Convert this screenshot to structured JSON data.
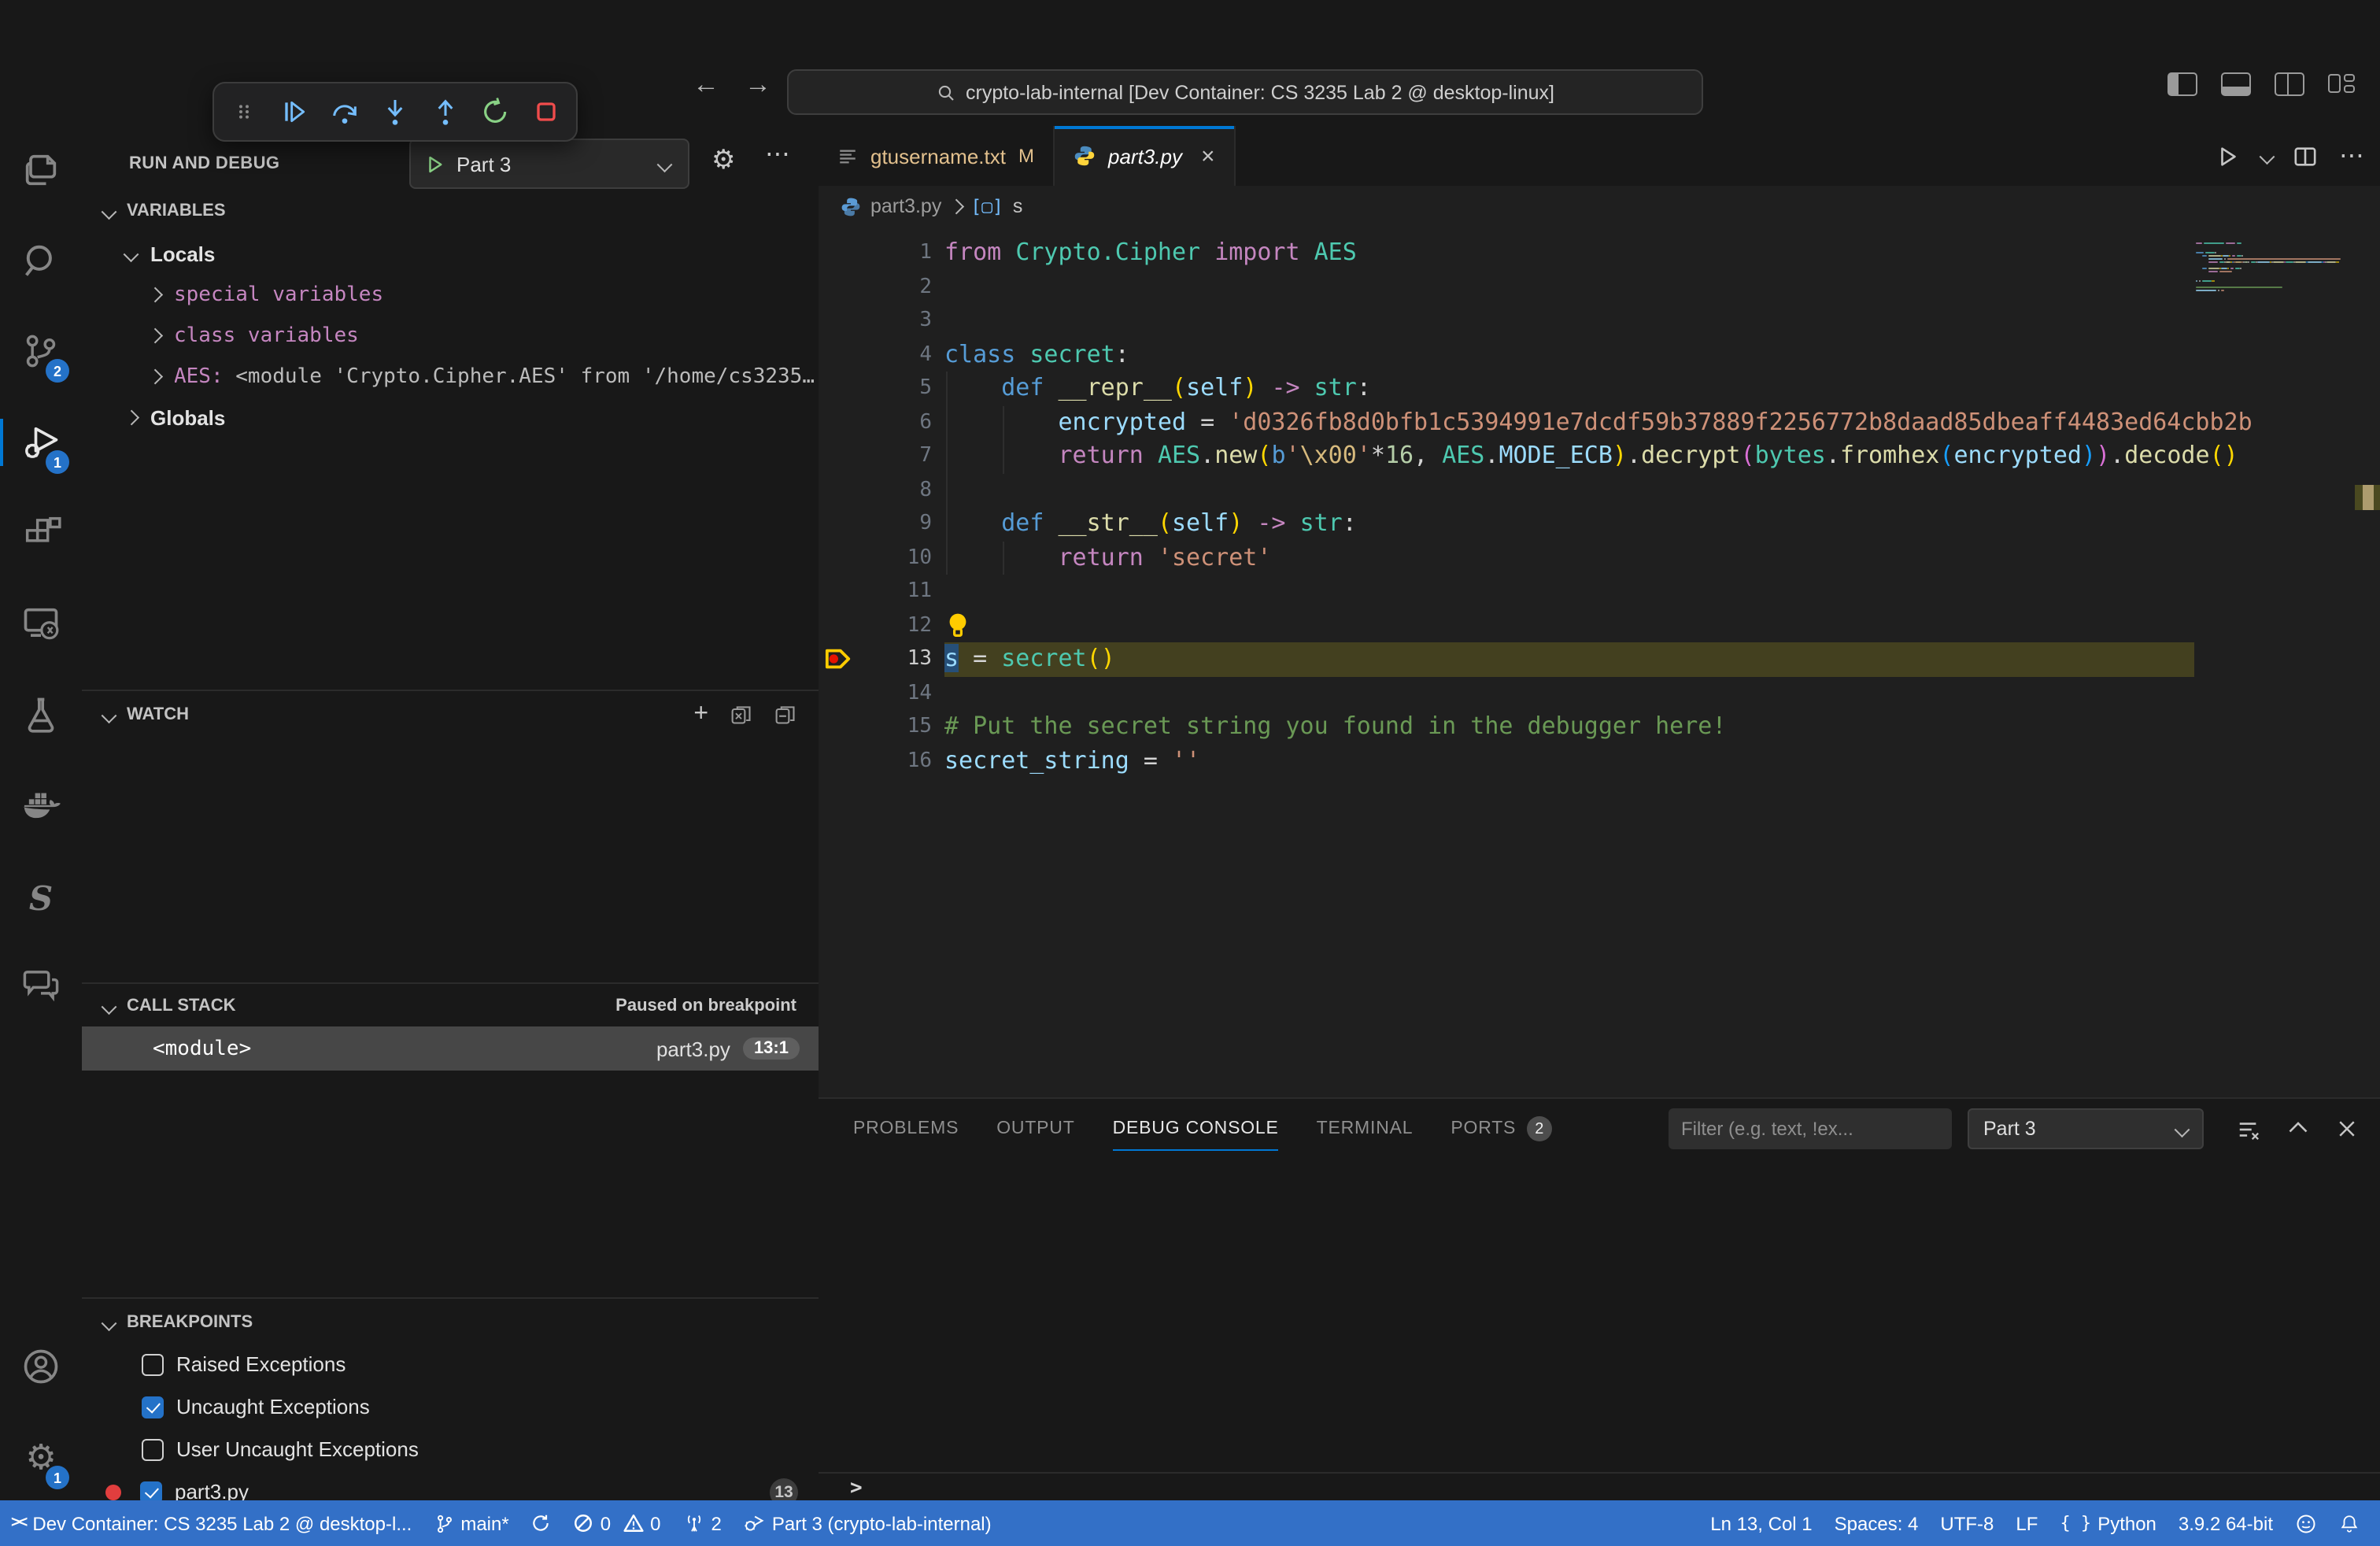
{
  "window": {
    "search_title": "crypto-lab-internal [Dev Container: CS 3235 Lab 2 @ desktop-linux]"
  },
  "debug_toolbar": {
    "buttons": [
      "gripper",
      "continue",
      "step-over",
      "step-into",
      "step-out",
      "restart",
      "stop"
    ]
  },
  "activity_bar": {
    "items": [
      {
        "name": "explorer"
      },
      {
        "name": "search"
      },
      {
        "name": "source-control",
        "badge": "2"
      },
      {
        "name": "run-and-debug",
        "badge": "1",
        "active": true
      },
      {
        "name": "extensions"
      },
      {
        "name": "remote-explorer"
      },
      {
        "name": "testing"
      },
      {
        "name": "docker"
      },
      {
        "name": "s-extension"
      },
      {
        "name": "comments"
      }
    ],
    "bottom_items": [
      {
        "name": "accounts"
      },
      {
        "name": "settings",
        "badge": "1"
      }
    ]
  },
  "sidebar": {
    "title": "RUN AND DEBUG",
    "config_dropdown": {
      "label": "Part 3"
    },
    "variables": {
      "header": "VARIABLES",
      "rows": [
        {
          "label": "Locals",
          "indent": 1,
          "expanded": true,
          "color": "#e3e3e3",
          "bold": true
        },
        {
          "label": "special variables",
          "indent": 2,
          "expanded": false,
          "color": "#c586c0"
        },
        {
          "label": "class variables",
          "indent": 2,
          "expanded": false,
          "color": "#c586c0"
        },
        {
          "label": "AES: ",
          "value": "<module 'Crypto.Cipher.AES' from '/home/cs3235…",
          "indent": 2,
          "expanded": false,
          "color": "#c586c0"
        },
        {
          "label": "Globals",
          "indent": 1,
          "expanded": false,
          "color": "#e3e3e3",
          "bold": true
        }
      ]
    },
    "watch": {
      "header": "WATCH",
      "actions": [
        "add-expression",
        "remove-all-expressions",
        "collapse-all"
      ]
    },
    "call_stack": {
      "header": "CALL STACK",
      "status": "Paused on breakpoint",
      "frames": [
        {
          "name": "<module>",
          "file": "part3.py",
          "position": "13:1"
        }
      ]
    },
    "breakpoints": {
      "header": "BREAKPOINTS",
      "items": [
        {
          "label": "Raised Exceptions",
          "checked": false
        },
        {
          "label": "Uncaught Exceptions",
          "checked": true
        },
        {
          "label": "User Uncaught Exceptions",
          "checked": false
        },
        {
          "label": "part3.py",
          "checked": true,
          "dot": true,
          "badge": "13"
        }
      ]
    }
  },
  "editor": {
    "tabs": [
      {
        "label": "gtusername.txt",
        "icon": "text-file",
        "modified_badge": "M",
        "active": false
      },
      {
        "label": "part3.py",
        "icon": "python",
        "active": true,
        "italic": true,
        "close": "×"
      }
    ],
    "breadcrumb": {
      "file": "part3.py",
      "symbol": "s"
    },
    "code": {
      "current_line": 13,
      "breakpoint_line": 13,
      "lightbulb_line": 12,
      "token_colors": {
        "kb": "#569CD6",
        "kp": "#C586C0",
        "ty": "#4EC9B0",
        "fn": "#DCDCAA",
        "va": "#9CDCFE",
        "st": "#CE9178",
        "es": "#D7BA7D",
        "nu": "#B5CEA8",
        "co": "#6A9955",
        "pl": "#D4D4D4",
        "p1": "#FFD700",
        "p2": "#DA70D6",
        "p3": "#179FFF"
      },
      "lines": [
        [
          [
            "from",
            "kp"
          ],
          [
            " ",
            "pl"
          ],
          [
            "Crypto.Cipher",
            "ty"
          ],
          [
            " ",
            "pl"
          ],
          [
            "import",
            "kp"
          ],
          [
            " ",
            "pl"
          ],
          [
            "AES",
            "ty"
          ]
        ],
        [],
        [],
        [
          [
            "class",
            "kb"
          ],
          [
            " ",
            "pl"
          ],
          [
            "secret",
            "ty"
          ],
          [
            ":",
            "pl"
          ]
        ],
        [
          [
            "    ",
            "pl"
          ],
          [
            "def",
            "kb"
          ],
          [
            " ",
            "pl"
          ],
          [
            "__repr__",
            "fn"
          ],
          [
            "(",
            "p1"
          ],
          [
            "self",
            "va"
          ],
          [
            ")",
            "p1"
          ],
          [
            " ",
            "pl"
          ],
          [
            "->",
            "kp"
          ],
          [
            " ",
            "pl"
          ],
          [
            "str",
            "ty"
          ],
          [
            ":",
            "pl"
          ]
        ],
        [
          [
            "        ",
            "pl"
          ],
          [
            "encrypted",
            "va"
          ],
          [
            " ",
            "pl"
          ],
          [
            "=",
            "pl"
          ],
          [
            " ",
            "pl"
          ],
          [
            "'d0326fb8d0bfb1c5394991e7dcdf59b37889f2256772b8daad85dbeaff4483ed64cbb2b",
            "st"
          ]
        ],
        [
          [
            "        ",
            "pl"
          ],
          [
            "return",
            "kp"
          ],
          [
            " ",
            "pl"
          ],
          [
            "AES",
            "ty"
          ],
          [
            ".",
            "pl"
          ],
          [
            "new",
            "fn"
          ],
          [
            "(",
            "p1"
          ],
          [
            "b",
            "kb"
          ],
          [
            "'",
            "st"
          ],
          [
            "\\x00",
            "es"
          ],
          [
            "'",
            "st"
          ],
          [
            "*",
            "pl"
          ],
          [
            "16",
            "nu"
          ],
          [
            ",",
            "pl"
          ],
          [
            " ",
            "pl"
          ],
          [
            "AES",
            "ty"
          ],
          [
            ".",
            "pl"
          ],
          [
            "MODE_ECB",
            "va"
          ],
          [
            ")",
            "p1"
          ],
          [
            ".",
            "pl"
          ],
          [
            "decrypt",
            "fn"
          ],
          [
            "(",
            "p2"
          ],
          [
            "bytes",
            "ty"
          ],
          [
            ".",
            "pl"
          ],
          [
            "fromhex",
            "fn"
          ],
          [
            "(",
            "p3"
          ],
          [
            "encrypted",
            "va"
          ],
          [
            ")",
            "p3"
          ],
          [
            ")",
            "p2"
          ],
          [
            ".",
            "pl"
          ],
          [
            "decode",
            "fn"
          ],
          [
            "(",
            "p1"
          ],
          [
            ")",
            "p1"
          ]
        ],
        [],
        [
          [
            "    ",
            "pl"
          ],
          [
            "def",
            "kb"
          ],
          [
            " ",
            "pl"
          ],
          [
            "__str__",
            "fn"
          ],
          [
            "(",
            "p1"
          ],
          [
            "self",
            "va"
          ],
          [
            ")",
            "p1"
          ],
          [
            " ",
            "pl"
          ],
          [
            "->",
            "kp"
          ],
          [
            " ",
            "pl"
          ],
          [
            "str",
            "ty"
          ],
          [
            ":",
            "pl"
          ]
        ],
        [
          [
            "        ",
            "pl"
          ],
          [
            "return",
            "kp"
          ],
          [
            " ",
            "pl"
          ],
          [
            "'secret'",
            "st"
          ]
        ],
        [],
        [],
        [
          [
            "s",
            "va",
            "sel"
          ],
          [
            " ",
            "pl"
          ],
          [
            "=",
            "pl"
          ],
          [
            " ",
            "pl"
          ],
          [
            "secret",
            "ty"
          ],
          [
            "(",
            "p1"
          ],
          [
            ")",
            "p1"
          ]
        ],
        [],
        [
          [
            "# Put the secret string you found in the debugger here!",
            "co"
          ]
        ],
        [
          [
            "secret_string",
            "va"
          ],
          [
            " ",
            "pl"
          ],
          [
            "=",
            "pl"
          ],
          [
            " ",
            "pl"
          ],
          [
            "''",
            "st"
          ]
        ]
      ]
    }
  },
  "panel": {
    "tabs": [
      {
        "label": "PROBLEMS"
      },
      {
        "label": "OUTPUT"
      },
      {
        "label": "DEBUG CONSOLE",
        "active": true
      },
      {
        "label": "TERMINAL"
      },
      {
        "label": "PORTS",
        "badge": "2"
      }
    ],
    "filter_placeholder": "Filter (e.g. text, !ex...",
    "dropdown": {
      "label": "Part 3"
    }
  },
  "status_bar": {
    "left": [
      {
        "icon": "remote-icon",
        "text": "Dev Container: CS 3235 Lab 2 @ desktop-l..."
      },
      {
        "icon": "branch-icon",
        "text": "main*"
      },
      {
        "icon": "sync-icon",
        "text": ""
      },
      {
        "icon": "errors-warnings-icon",
        "text": "0|0"
      },
      {
        "icon": "radio-tower-icon",
        "text": "2"
      },
      {
        "icon": "debug-icon",
        "text": "Part 3 (crypto-lab-internal)"
      }
    ],
    "right": [
      {
        "text": "Ln 13, Col 1"
      },
      {
        "text": "Spaces: 4"
      },
      {
        "text": "UTF-8"
      },
      {
        "text": "LF"
      },
      {
        "icon": "braces-icon",
        "text": "Python"
      },
      {
        "text": "3.9.2 64-bit"
      },
      {
        "icon": "feedback-icon",
        "text": ""
      },
      {
        "icon": "bell-icon",
        "text": ""
      }
    ]
  }
}
